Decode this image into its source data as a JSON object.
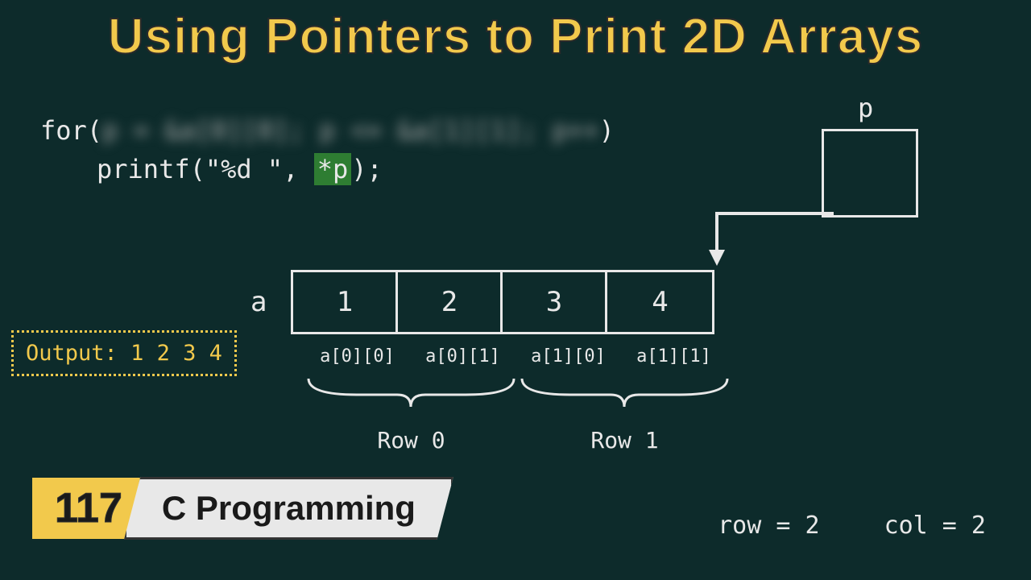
{
  "title": "Using Pointers to Print 2D Arrays",
  "code": {
    "line1_prefix": "for(",
    "line1_blur": "p = &a[0][0]; p <= &a[1][1]; p++",
    "line1_suffix": ")",
    "line2_prefix": "printf(\"%d \", ",
    "line2_highlight": "*p",
    "line2_suffix": ");"
  },
  "pointer_label": "p",
  "array": {
    "name": "a",
    "cells": [
      "1",
      "2",
      "3",
      "4"
    ],
    "indices": [
      "a[0][0]",
      "a[0][1]",
      "a[1][0]",
      "a[1][1]"
    ],
    "row_labels": [
      "Row 0",
      "Row 1"
    ]
  },
  "output": {
    "label": "Output:",
    "values": "1 2 3 4"
  },
  "footer": {
    "lesson_number": "117",
    "series_title": "C Programming"
  },
  "dimensions": {
    "row": "row = 2",
    "col": "col = 2"
  }
}
